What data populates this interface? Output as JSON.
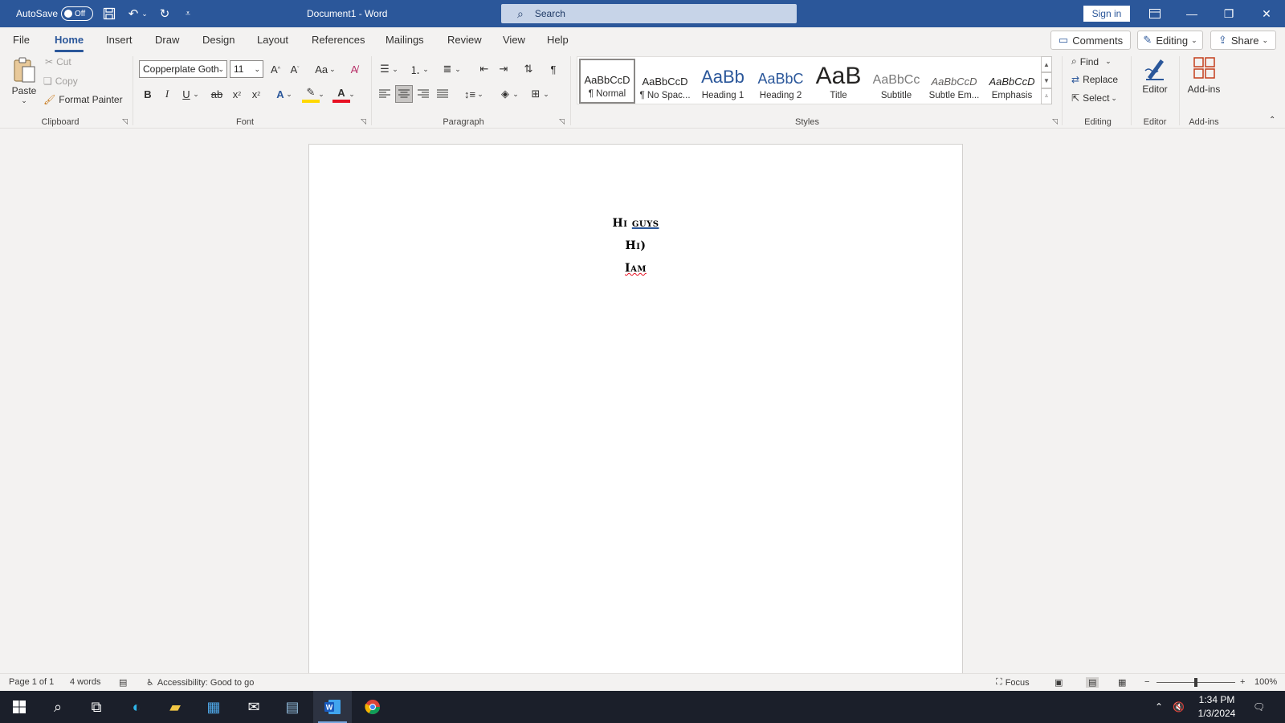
{
  "titlebar": {
    "autosave_label": "AutoSave",
    "autosave_state": "Off",
    "doc_title": "Document1 - Word",
    "search_placeholder": "Search",
    "sign_in": "Sign in",
    "color": "#2b579a"
  },
  "tabs": [
    "File",
    "Home",
    "Insert",
    "Draw",
    "Design",
    "Layout",
    "References",
    "Mailings",
    "Review",
    "View",
    "Help"
  ],
  "active_tab": "Home",
  "tab_buttons": {
    "comments": "Comments",
    "editing": "Editing",
    "share": "Share"
  },
  "clipboard": {
    "paste": "Paste",
    "cut": "Cut",
    "copy": "Copy",
    "format_painter": "Format Painter",
    "label": "Clipboard"
  },
  "font": {
    "name": "Copperplate Goth",
    "size": "11",
    "label": "Font",
    "case_btn": "Aa"
  },
  "paragraph": {
    "label": "Paragraph"
  },
  "styles": {
    "label": "Styles",
    "items": [
      {
        "preview": "AaBbCcD",
        "name": "¶ Normal"
      },
      {
        "preview": "AaBbCcD",
        "name": "¶ No Spac..."
      },
      {
        "preview": "AaBb",
        "name": "Heading 1"
      },
      {
        "preview": "AaBbC",
        "name": "Heading 2"
      },
      {
        "preview": "AaB",
        "name": "Title"
      },
      {
        "preview": "AaBbCc",
        "name": "Subtitle"
      },
      {
        "preview": "AaBbCcD",
        "name": "Subtle Em..."
      },
      {
        "preview": "AaBbCcD",
        "name": "Emphasis"
      }
    ]
  },
  "editing": {
    "find": "Find",
    "replace": "Replace",
    "select": "Select",
    "label": "Editing"
  },
  "editor": {
    "button": "Editor",
    "label": "Editor"
  },
  "addins": {
    "button": "Add-ins",
    "label": "Add-ins"
  },
  "document": {
    "line1_a": "Hi",
    "line1_b": "guys",
    "line2": "Hi)",
    "line3": "Iam"
  },
  "status": {
    "page": "Page 1 of 1",
    "words": "4 words",
    "accessibility": "Accessibility: Good to go",
    "focus": "Focus",
    "zoom": "100%",
    "zoom_minus": "−",
    "zoom_plus": "+"
  },
  "taskbar": {
    "time": "1:34 PM",
    "date": "1/3/2024"
  }
}
